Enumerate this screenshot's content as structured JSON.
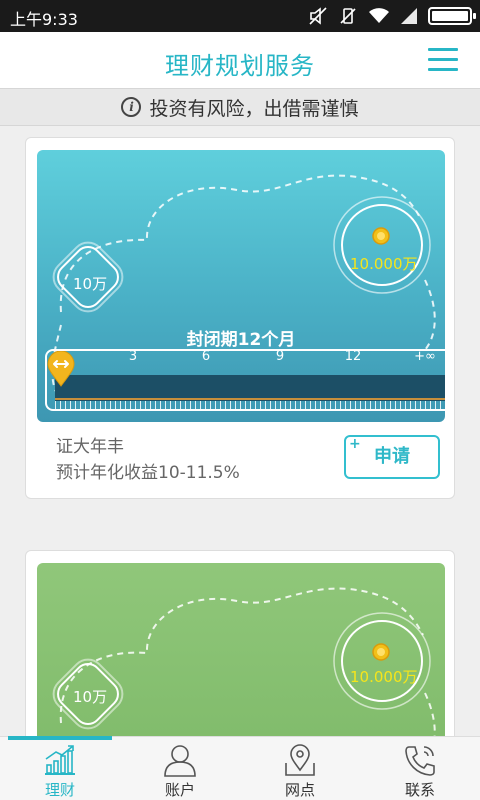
{
  "status_bar": {
    "time": "上午9:33",
    "icons": [
      "mute-icon",
      "vibrate-off-icon",
      "wifi-icon",
      "signal-icon",
      "battery-icon"
    ]
  },
  "header": {
    "title": "理财规划服务",
    "menu_icon": "hamburger-menu-icon"
  },
  "notice": {
    "icon": "info-icon",
    "icon_glyph": "i",
    "text": "投资有风险，出借需谨慎"
  },
  "products": [
    {
      "min_amount": "10万",
      "expected_amount": "10.000万",
      "period_label": "封闭期12个月",
      "slider_ticks": [
        "0",
        "3",
        "6",
        "9",
        "12",
        "+∞"
      ],
      "slider_value_months": 0,
      "name": "证大年丰",
      "rate_text": "预计年化收益10-11.5%",
      "apply_label": "申请",
      "apply_plus": "+",
      "theme_color": "#4ab0c6"
    },
    {
      "min_amount": "10万",
      "expected_amount": "10.000万",
      "theme_color": "#7cb867"
    }
  ],
  "tabs": [
    {
      "label": "理财",
      "icon": "chart-growth-icon",
      "active": true
    },
    {
      "label": "账户",
      "icon": "user-icon",
      "active": false
    },
    {
      "label": "网点",
      "icon": "map-pin-icon",
      "active": false
    },
    {
      "label": "联系",
      "icon": "phone-icon",
      "active": false
    }
  ],
  "colors": {
    "accent": "#27b6c6",
    "coin_text": "#f5e51b",
    "slider_track": "#1c4f66"
  }
}
